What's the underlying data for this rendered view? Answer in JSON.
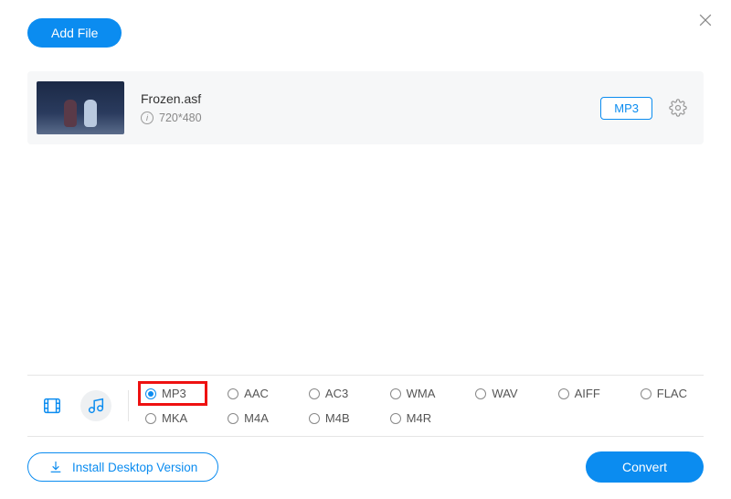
{
  "colors": {
    "accent": "#0b8cf0"
  },
  "buttons": {
    "add_file": "Add File",
    "install_desktop": "Install Desktop Version",
    "convert": "Convert"
  },
  "file": {
    "name": "Frozen.asf",
    "resolution": "720*480",
    "output_badge": "MP3"
  },
  "format_panel": {
    "selected": "MP3",
    "highlighted": "MP3",
    "row1": [
      "MP3",
      "AAC",
      "AC3",
      "WMA",
      "WAV",
      "AIFF",
      "FLAC"
    ],
    "row2": [
      "MKA",
      "M4A",
      "M4B",
      "M4R"
    ]
  }
}
